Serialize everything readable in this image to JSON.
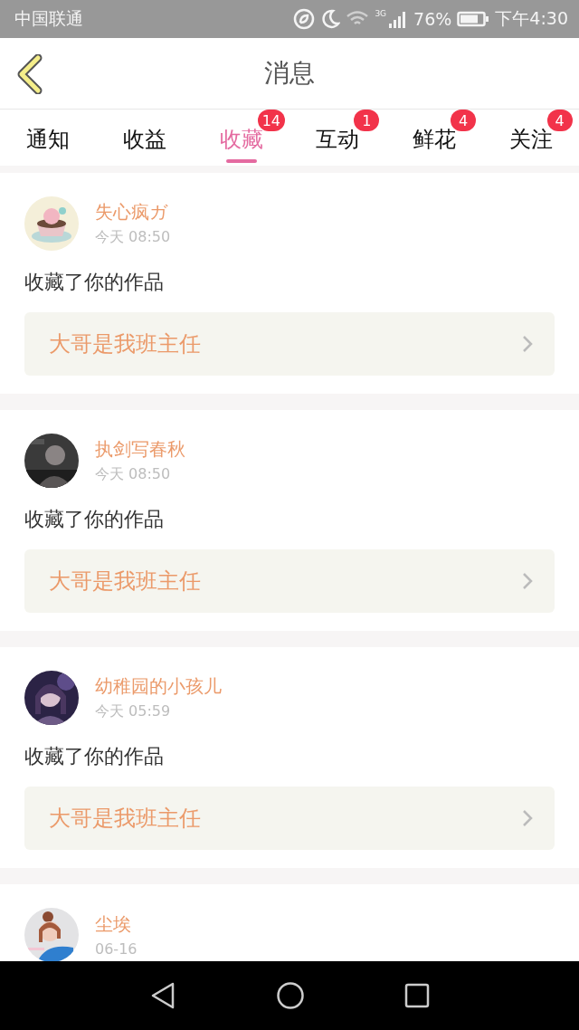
{
  "status_bar": {
    "carrier": "中国联通",
    "network": "3G",
    "battery": "76%",
    "time": "下午4:30"
  },
  "header": {
    "title": "消息"
  },
  "tabs": [
    {
      "label": "通知",
      "selected": false
    },
    {
      "label": "收益",
      "selected": false
    },
    {
      "label": "收藏",
      "selected": true,
      "badge": "14"
    },
    {
      "label": "互动",
      "selected": false,
      "badge": "1"
    },
    {
      "label": "鲜花",
      "selected": false,
      "badge": "4"
    },
    {
      "label": "关注",
      "selected": false,
      "badge": "4"
    }
  ],
  "messages": [
    {
      "user": "失心疯ガ",
      "time": "今天 08:50",
      "action": "收藏了你的作品",
      "work": "大哥是我班主任"
    },
    {
      "user": "执剑写春秋",
      "time": "今天 08:50",
      "action": "收藏了你的作品",
      "work": "大哥是我班主任"
    },
    {
      "user": "幼稚园的小孩儿",
      "time": "今天 05:59",
      "action": "收藏了你的作品",
      "work": "大哥是我班主任"
    },
    {
      "user": "尘埃",
      "time": "06-16"
    }
  ]
}
